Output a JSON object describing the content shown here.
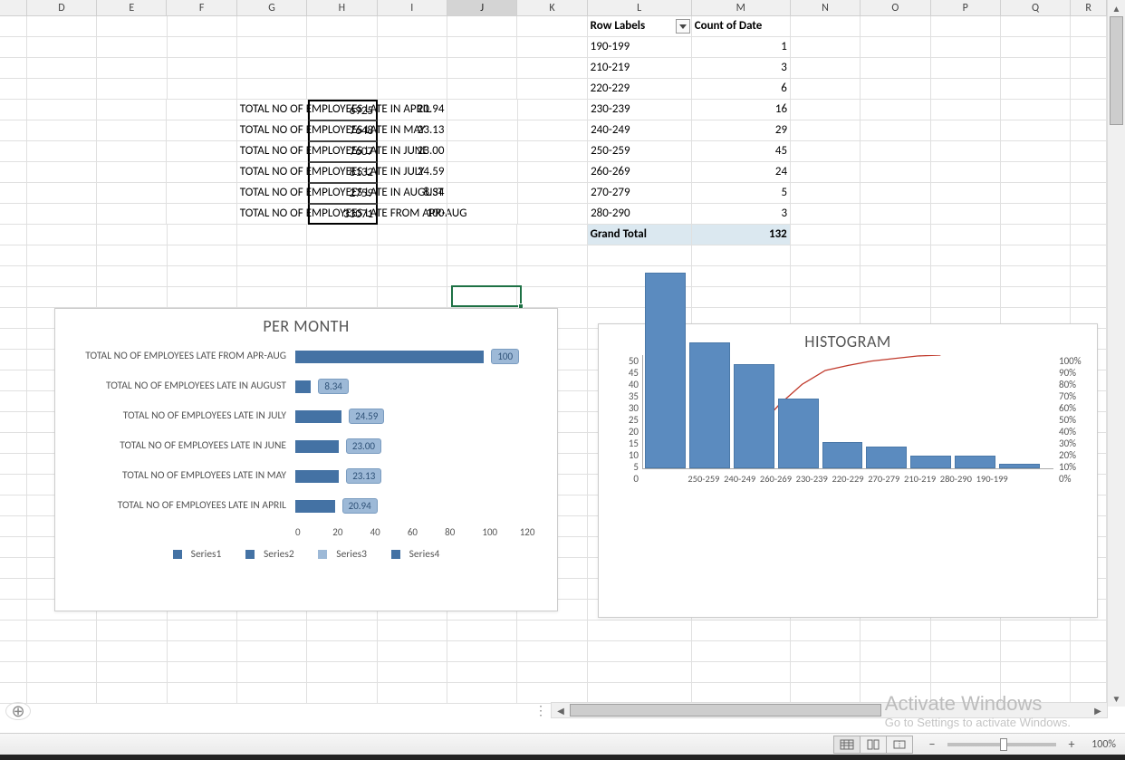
{
  "columns": [
    "D",
    "E",
    "F",
    "G",
    "H",
    "I",
    "J",
    "K",
    "L",
    "M",
    "N",
    "O",
    "P",
    "Q",
    "R"
  ],
  "active_column": "J",
  "employee_late": {
    "rows": [
      {
        "label": "TOTAL NO OF EMPLOYEES LATE IN APRIL",
        "count": 6925,
        "pct": "20.94"
      },
      {
        "label": "TOTAL NO OF EMPLOYEES LATE IN MAY",
        "count": 7648,
        "pct": "23.13"
      },
      {
        "label": "TOTAL NO OF EMPLOYEES LATE IN JUNE",
        "count": 7607,
        "pct": "23.00"
      },
      {
        "label": "TOTAL NO OF EMPLOYEES LATE IN JULY",
        "count": 8132,
        "pct": "24.59"
      },
      {
        "label": "TOTAL NO OF EMPLOYEES LATE IN AUGUST",
        "count": 2759,
        "pct": "8.34"
      },
      {
        "label": "TOTAL NO OF EMPLOYEES LATE FROM APR-AUG",
        "count": 33071,
        "pct": "100"
      }
    ]
  },
  "pivot": {
    "header_label": "Row Labels",
    "header_count": "Count of Date",
    "rows": [
      {
        "bin": "190-199",
        "count": 1
      },
      {
        "bin": "210-219",
        "count": 3
      },
      {
        "bin": "220-229",
        "count": 6
      },
      {
        "bin": "230-239",
        "count": 16
      },
      {
        "bin": "240-249",
        "count": 29
      },
      {
        "bin": "250-259",
        "count": 45
      },
      {
        "bin": "260-269",
        "count": 24
      },
      {
        "bin": "270-279",
        "count": 5
      },
      {
        "bin": "280-290",
        "count": 3
      }
    ],
    "total_label": "Grand Total",
    "total_value": 132
  },
  "chart_data": [
    {
      "type": "bar",
      "orientation": "horizontal",
      "title": "PER MONTH",
      "categories": [
        "TOTAL NO OF EMPLOYEES LATE FROM APR-AUG",
        "TOTAL NO OF EMPLOYEES LATE IN AUGUST",
        "TOTAL NO OF EMPLOYEES LATE IN JULY",
        "TOTAL NO OF EMPLOYEES LATE IN JUNE",
        "TOTAL NO OF EMPLOYEES LATE IN MAY",
        "TOTAL NO OF EMPLOYEES LATE IN APRIL"
      ],
      "values": [
        100,
        8.34,
        24.59,
        23.0,
        23.13,
        20.94
      ],
      "data_labels": [
        "100",
        "8.34",
        "24.59",
        "23.00",
        "23.13",
        "20.94"
      ],
      "xlim": [
        0,
        120
      ],
      "xticks": [
        0,
        20,
        40,
        60,
        80,
        100,
        120
      ],
      "legend": [
        "Series1",
        "Series2",
        "Series3",
        "Series4"
      ]
    },
    {
      "type": "histogram_pareto",
      "title": "HISTOGRAM",
      "categories": [
        "250-259",
        "240-249",
        "260-269",
        "230-239",
        "220-229",
        "270-279",
        "210-219",
        "280-290",
        "190-199"
      ],
      "bar_values": [
        45,
        29,
        24,
        16,
        6,
        5,
        3,
        3,
        1
      ],
      "y_left_ticks": [
        0,
        5,
        10,
        15,
        20,
        25,
        30,
        35,
        40,
        45,
        50
      ],
      "y_right_ticks": [
        "0%",
        "10%",
        "20%",
        "30%",
        "40%",
        "50%",
        "60%",
        "70%",
        "80%",
        "90%",
        "100%"
      ],
      "cumulative_pct": [
        34.1,
        56.1,
        74.2,
        86.4,
        90.9,
        94.7,
        97.0,
        99.2,
        100.0
      ],
      "ylim": [
        0,
        50
      ]
    }
  ],
  "legend_labels": {
    "s1": "Series1",
    "s2": "Series2",
    "s3": "Series3",
    "s4": "Series4"
  },
  "watermark": {
    "title": "Activate Windows",
    "sub": "Go to Settings to activate Windows."
  },
  "statusbar": {
    "zoom": "100%"
  }
}
